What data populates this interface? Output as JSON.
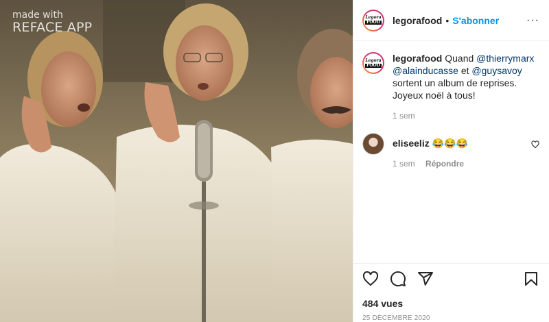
{
  "media": {
    "watermark_line1": "made with",
    "watermark_line2": "REFACE APP"
  },
  "header": {
    "avatar_logo_line1": "Legora",
    "avatar_logo_line2": "FOOD",
    "username": "legorafood",
    "separator": "•",
    "follow_label": "S'abonner",
    "more_label": "···"
  },
  "caption": {
    "username": "legorafood",
    "text_1": "Quand",
    "mention_1": "@thierrymarx",
    "mention_2": "@alainducasse",
    "text_2": "et",
    "mention_3": "@guysavoy",
    "text_3": "sortent un album de reprises. Joyeux noël à tous!",
    "time": "1 sem"
  },
  "comments": [
    {
      "username": "eliseeliz",
      "text": "😂😂😂",
      "time": "1 sem",
      "reply_label": "Répondre"
    }
  ],
  "actions": {
    "icons": [
      "heart-icon",
      "comment-icon",
      "share-icon",
      "bookmark-icon"
    ],
    "views": "484 vues",
    "date": "25 DÉCEMBRE 2020"
  },
  "colors": {
    "link_blue": "#0095f6",
    "mention_blue": "#00376b",
    "muted_gray": "#8e8e8e",
    "text": "#262626",
    "divider": "#efefef"
  }
}
